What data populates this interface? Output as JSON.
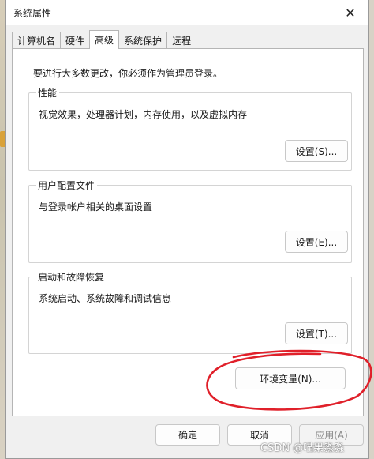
{
  "window": {
    "title": "系统属性",
    "close_glyph": "✕"
  },
  "tabs": [
    {
      "label": "计算机名",
      "active": false
    },
    {
      "label": "硬件",
      "active": false
    },
    {
      "label": "高级",
      "active": true
    },
    {
      "label": "系统保护",
      "active": false
    },
    {
      "label": "远程",
      "active": false
    }
  ],
  "admin_note": "要进行大多数更改，你必须作为管理员登录。",
  "performance": {
    "legend": "性能",
    "description": "视觉效果，处理器计划，内存使用，以及虚拟内存",
    "button": "设置(S)..."
  },
  "user_profiles": {
    "legend": "用户配置文件",
    "description": "与登录帐户相关的桌面设置",
    "button": "设置(E)..."
  },
  "startup_recovery": {
    "legend": "启动和故障恢复",
    "description": "系统启动、系统故障和调试信息",
    "button": "设置(T)..."
  },
  "env_button": "环境变量(N)...",
  "footer": {
    "ok": "确定",
    "cancel": "取消",
    "apply": "应用(A)"
  },
  "watermark": "CSDN @喵果淼淼",
  "colors": {
    "annotation_red": "#e0202a",
    "dialog_bg": "#f0f0f0",
    "panel_bg": "#ffffff"
  }
}
